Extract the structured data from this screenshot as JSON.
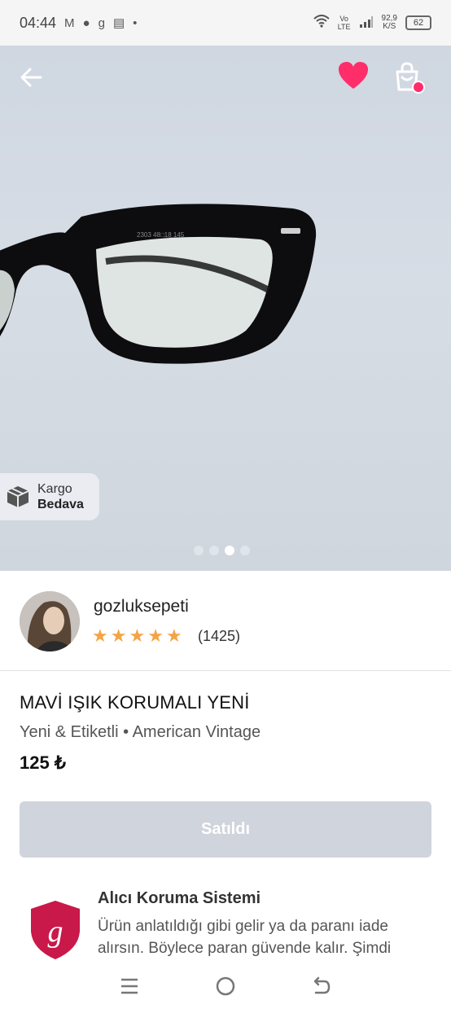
{
  "status_bar": {
    "time": "04:44",
    "network_speed_value": "92,9",
    "network_speed_unit": "K/S",
    "net_label_top": "Vo",
    "net_label_bottom": "LTE",
    "battery": "62",
    "notif_g": "g"
  },
  "shipping_badge": {
    "line1": "Kargo",
    "line2": "Bedava"
  },
  "carousel": {
    "total": 4,
    "active_index": 2
  },
  "seller": {
    "name": "gozluksepeti",
    "rating_stars": 5,
    "rating_count": "(1425)"
  },
  "product": {
    "title": "MAVİ IŞIK KORUMALI YENİ",
    "meta": "Yeni & Etiketli • American Vintage",
    "price": "125 ₺"
  },
  "sold_button": {
    "label": "Satıldı"
  },
  "protection": {
    "title": "Alıcı Koruma Sistemi",
    "text": "Ürün anlatıldığı gibi gelir ya da paranı iade alırsın. Böylece paran güvende kalır. Şimdi",
    "icon_letter": "g"
  },
  "colors": {
    "accent": "#ff2d6a",
    "star": "#f4a444",
    "sold_bg": "#d0d4dc",
    "shield": "#c9184a"
  },
  "icons": [
    "back-arrow-icon",
    "heart-icon",
    "shopping-bag-icon",
    "box-icon",
    "star-icon",
    "menu-icon",
    "home-circle-icon",
    "back-nav-icon"
  ]
}
